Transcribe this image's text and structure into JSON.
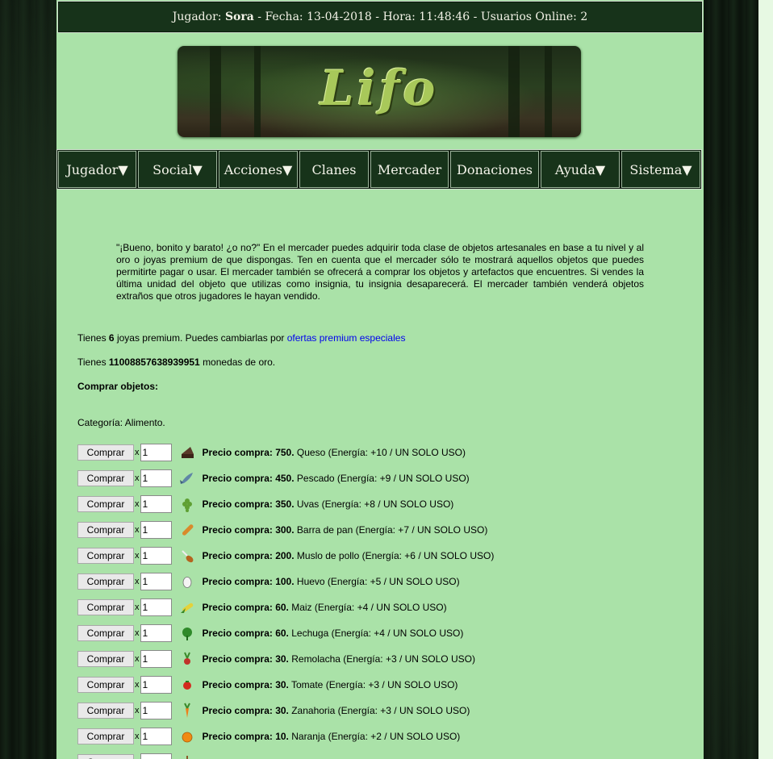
{
  "header": {
    "jugador_label": "Jugador:",
    "jugador_value": "Sora",
    "fecha_label": "- Fecha:",
    "fecha_value": "13-04-2018",
    "hora_label": "- Hora:",
    "hora_value": "11:48:46",
    "online_label": "- Usuarios Online:",
    "online_value": "2"
  },
  "banner": {
    "title": "Lifo"
  },
  "nav": {
    "items": [
      "Jugador▼",
      "Social▼",
      "Acciones▼",
      "Clanes",
      "Mercader",
      "Donaciones",
      "Ayuda▼",
      "Sistema▼"
    ]
  },
  "intro": "\"¡Bueno, bonito y barato! ¿o no?\" En el mercader puedes adquirir toda clase de objetos artesanales en base a tu nivel y al oro o joyas premium de que dispongas. Ten en cuenta que el mercader sólo te mostrará aquellos objetos que puedes permitirte pagar o usar. El mercader también se ofrecerá a comprar los objetos y artefactos que encuentres. Si vendes la última unidad del objeto que utilizas como insignia, tu insignia desaparecerá. El mercader también venderá objetos extraños que otros jugadores le hayan vendido.",
  "jewels": {
    "prefix": "Tienes",
    "count": "6",
    "suffix": "joyas premium. Puedes cambiarlas por",
    "link": "ofertas premium especiales"
  },
  "gold": {
    "prefix": "Tienes",
    "amount": "11008857638939951",
    "suffix": "monedas de oro."
  },
  "buy_heading": "Comprar objetos:",
  "category": "Categoría: Alimento.",
  "buy_label": "Comprar",
  "x_label": "x",
  "items": [
    {
      "price": "Precio compra: 750.",
      "desc": "Queso (Energía: +10 / UN SOLO USO)",
      "qty": "1",
      "icon": "cheese-icon",
      "color": "#5a3a2a"
    },
    {
      "price": "Precio compra: 450.",
      "desc": "Pescado (Energía: +9 / UN SOLO USO)",
      "qty": "1",
      "icon": "fish-icon",
      "color": "#5f86a6"
    },
    {
      "price": "Precio compra: 350.",
      "desc": "Uvas (Energía: +8 / UN SOLO USO)",
      "qty": "1",
      "icon": "grapes-icon",
      "color": "#5fa033"
    },
    {
      "price": "Precio compra: 300.",
      "desc": "Barra de pan (Energía: +7 / UN SOLO USO)",
      "qty": "1",
      "icon": "bread-icon",
      "color": "#d98a2b"
    },
    {
      "price": "Precio compra: 200.",
      "desc": "Muslo de pollo (Energía: +6 / UN SOLO USO)",
      "qty": "1",
      "icon": "chicken-leg-icon",
      "color": "#b5641f"
    },
    {
      "price": "Precio compra: 100.",
      "desc": "Huevo (Energía: +5 / UN SOLO USO)",
      "qty": "1",
      "icon": "egg-icon",
      "color": "#f4f4f4"
    },
    {
      "price": "Precio compra: 60.",
      "desc": "Maiz (Energía: +4 / UN SOLO USO)",
      "qty": "1",
      "icon": "corn-icon",
      "color": "#e4d23a"
    },
    {
      "price": "Precio compra: 60.",
      "desc": "Lechuga (Energía: +4 / UN SOLO USO)",
      "qty": "1",
      "icon": "lettuce-icon",
      "color": "#2f8a2a"
    },
    {
      "price": "Precio compra: 30.",
      "desc": "Remolacha (Energía: +3 / UN SOLO USO)",
      "qty": "1",
      "icon": "beet-icon",
      "color": "#c0322a"
    },
    {
      "price": "Precio compra: 30.",
      "desc": "Tomate (Energía: +3 / UN SOLO USO)",
      "qty": "1",
      "icon": "tomato-icon",
      "color": "#d42a1f"
    },
    {
      "price": "Precio compra: 30.",
      "desc": "Zanahoria (Energía: +3 / UN SOLO USO)",
      "qty": "1",
      "icon": "carrot-icon",
      "color": "#ef7f1a"
    },
    {
      "price": "Precio compra: 10.",
      "desc": "Naranja (Energía: +2 / UN SOLO USO)",
      "qty": "1",
      "icon": "orange-icon",
      "color": "#f08a12"
    },
    {
      "price": "",
      "desc": "",
      "qty": "",
      "icon": "item-icon",
      "color": "#8a5a2a"
    }
  ]
}
